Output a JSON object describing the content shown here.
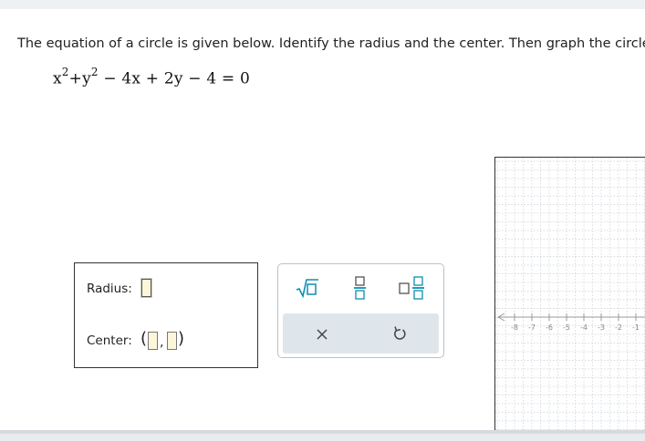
{
  "question": {
    "prompt": "The equation of a circle is given below. Identify the radius and the center. Then graph the circle."
  },
  "equation": {
    "x_term": "x",
    "y_term": "+y",
    "exp": "2",
    "rest": " − 4x + 2y − 4 = 0"
  },
  "answer": {
    "radius_label": "Radius:",
    "center_label": "Center:",
    "open_paren": "(",
    "comma": ",",
    "close_paren": ")"
  },
  "toolbox": {
    "tools": [
      "sqrt-icon",
      "fraction-icon",
      "mixed-number-icon",
      "clear-icon",
      "undo-icon"
    ]
  },
  "graph": {
    "x_ticks": [
      "-8",
      "-7",
      "-6",
      "-5",
      "-4",
      "-3",
      "-2",
      "-1"
    ],
    "grid": true
  },
  "colors": {
    "accent": "#0b8fb0",
    "slot_fill": "#fdf6d8",
    "grid_line": "#c9cfd6",
    "toolbar_bg": "#dfe6eb"
  }
}
